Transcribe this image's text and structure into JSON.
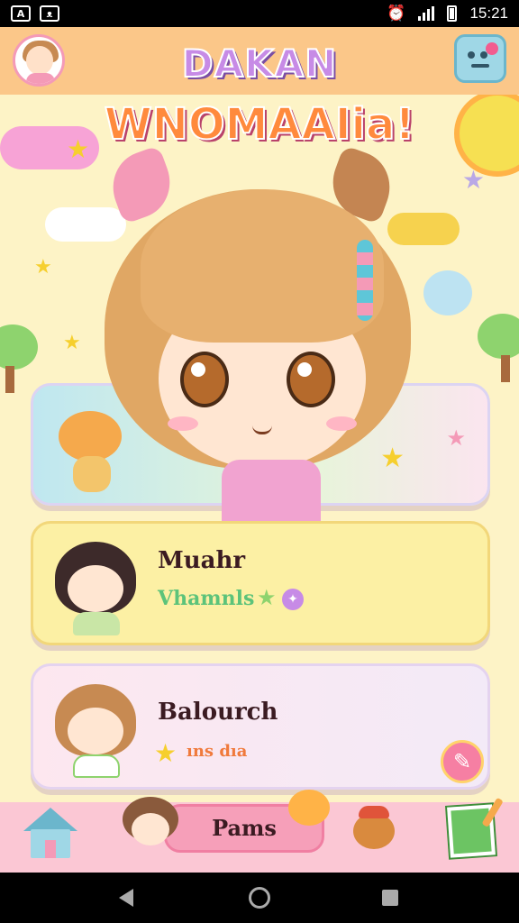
{
  "status_bar": {
    "time": "15:21",
    "left_icons": [
      "notification-icon",
      "cat-icon"
    ],
    "right_icons": [
      "alarm-icon",
      "signal-icon",
      "battery-icon"
    ]
  },
  "header": {
    "title_line1": "DAKAN",
    "title_line2": "WNOMAAIia!",
    "left_button": "profile-avatar",
    "right_button": "menu-face-button"
  },
  "hero_card": {
    "character": "girl-with-cat-ears",
    "mascot": "orange-cat"
  },
  "cards": [
    {
      "name": "Muahr",
      "subtitle": "Vhamnls",
      "badges": [
        "star-icon",
        "sparkle-icon"
      ]
    },
    {
      "name": "Balourch",
      "subtitle": "ıns dıa",
      "badges": [
        "star-icon"
      ],
      "action": "edit-icon"
    }
  ],
  "bottom_nav": {
    "home_icon": "house-icon",
    "center_button": "Pams",
    "right_icon": "notepad-pencil-icon"
  },
  "colors": {
    "header_bg": "#fbc789",
    "app_bg": "#fdf3c6",
    "card1_bg": "#fcf0a4",
    "accent_pink": "#f69fb9",
    "accent_blue": "#9fd7e6"
  }
}
